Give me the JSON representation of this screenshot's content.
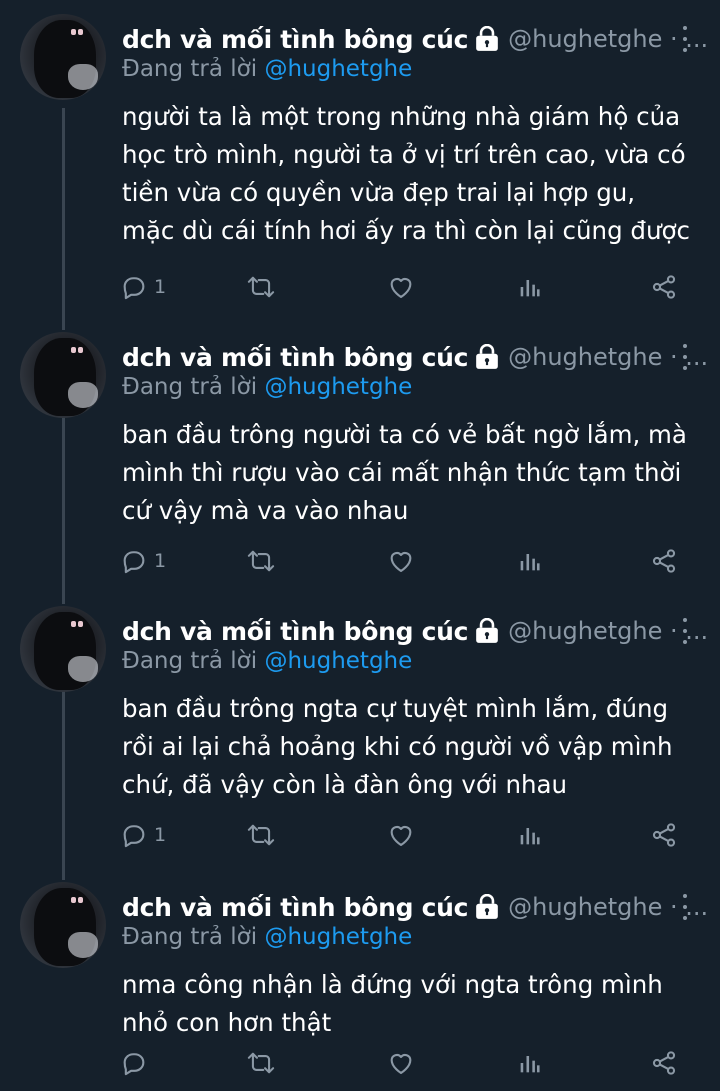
{
  "colors": {
    "background": "#15202b",
    "secondary_text": "#8b98a5",
    "mention": "#1d9bf0",
    "thread_line": "#3a4551"
  },
  "tweets": [
    {
      "name": "dch và mối tình bông cúc",
      "handle": "@hughetghe · ...",
      "reply_prefix": "Đang trả lời",
      "reply_to": "@hughetghe",
      "text": "người ta là một trong những nhà giám hộ của học trò mình, người ta ở vị trí trên cao, vừa có tiền vừa có quyền vừa đẹp trai lại hợp gu, mặc dù cái tính hơi ấy ra thì còn lại cũng được",
      "reply_count": "1"
    },
    {
      "name": "dch và mối tình bông cúc",
      "handle": "@hughetghe · ...",
      "reply_prefix": "Đang trả lời",
      "reply_to": "@hughetghe",
      "text": "ban đầu trông người ta có vẻ bất ngờ lắm, mà mình thì rượu vào cái mất nhận thức tạm thời cứ vậy mà va vào nhau",
      "reply_count": "1"
    },
    {
      "name": "dch và mối tình bông cúc",
      "handle": "@hughetghe · ...",
      "reply_prefix": "Đang trả lời",
      "reply_to": "@hughetghe",
      "text": "ban đầu trông ngta cự tuyệt mình lắm, đúng rồi ai lại chả hoảng khi có người vồ vập mình chứ, đã vậy còn là đàn ông với nhau",
      "reply_count": "1"
    },
    {
      "name": "dch và mối tình bông cúc",
      "handle": "@hughetghe · ...",
      "reply_prefix": "Đang trả lời",
      "reply_to": "@hughetghe",
      "text": "nma công nhận là đứng với ngta trông mình nhỏ con hơn thật",
      "reply_count": ""
    }
  ],
  "icons": [
    "lock-icon",
    "more-icon",
    "reply-icon",
    "retweet-icon",
    "like-icon",
    "views-icon",
    "share-icon"
  ]
}
